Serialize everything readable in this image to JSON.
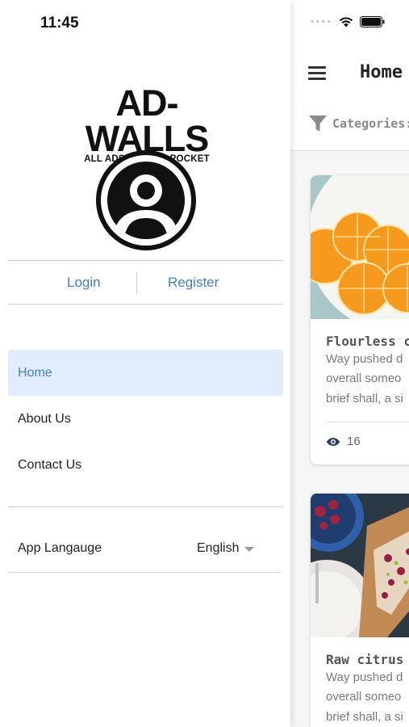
{
  "status_bar": {
    "time": "11:45"
  },
  "drawer": {
    "logo": {
      "main": "AD-WALLS",
      "tagline": "ALL ADS IN YOUR POCKET"
    },
    "auth": {
      "login_label": "Login",
      "register_label": "Register"
    },
    "nav_items": [
      {
        "label": "Home",
        "active": true
      },
      {
        "label": "About Us",
        "active": false
      },
      {
        "label": "Contact Us",
        "active": false
      }
    ],
    "language": {
      "label": "App Langauge",
      "value": "English"
    }
  },
  "app": {
    "title": "Home",
    "categories_label": "Categories:",
    "cards": [
      {
        "title": "Flourless c",
        "lines": [
          "Way pushed d",
          "overall someo",
          "brief shall, a si"
        ],
        "views": "16"
      },
      {
        "title": "Raw citrus",
        "lines": [
          "Way pushed d",
          "overall someo",
          "brief shall, a si"
        ]
      }
    ]
  },
  "colors": {
    "accent": "#3f7fcf",
    "active_bg": "#e1ecfd"
  }
}
